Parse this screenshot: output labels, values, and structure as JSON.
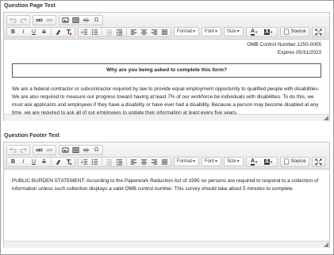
{
  "page": {
    "question_page_text_label": "Question Page Text",
    "question_footer_text_label": "Question Footer Text"
  },
  "toolbar": {
    "format_label": "Format",
    "font_label": "Font",
    "size_label": "Size",
    "source_label": "Source",
    "bold": "B",
    "italic": "I",
    "underline": "U",
    "strike": "S",
    "omega": "Ω"
  },
  "editor1": {
    "omb_control": "OMB Control Number 1250-0005",
    "expires": "Expires 05/31/2023",
    "box_question": "Why are you being asked to complete this form?",
    "paragraph": "We are a federal contractor or subcontractor required by law to provide equal employment opportunity to qualified people with disabilities. We are also required to measure our progress toward having at least 7% of our workforce be individuals with disabilities. To do this, we must ask applicants and employees if they have a disability or have ever had a disability. Because a person may become disabled at any time, we are required to ask all of our employees to update their information at least every five years."
  },
  "editor2": {
    "paragraph": "PUBLIC BURDEN STATEMENT: According to the Paperwork Reduction Act of 1995 no persons are required to respond to a collection of information unless such collection displays a valid OMB control number. This survey should take about 5 minutes to complete."
  },
  "colors": {
    "toolbar_bg": "#e6e6e6",
    "border": "#c4c4c4"
  }
}
